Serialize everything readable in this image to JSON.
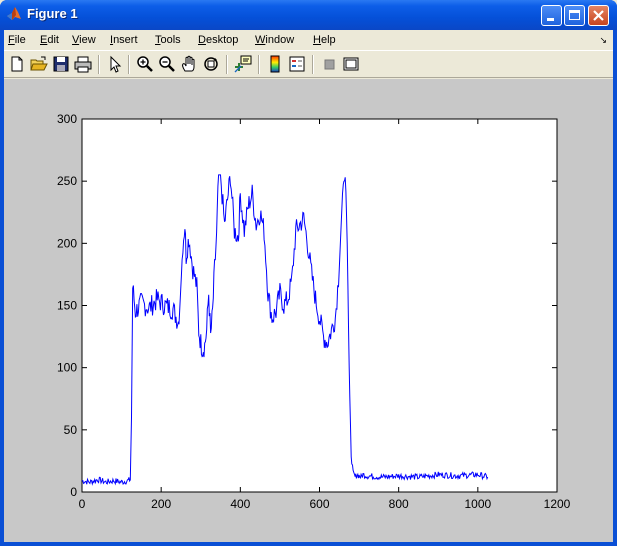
{
  "window": {
    "title": "Figure 1",
    "title_icon": "matlab-logo-icon",
    "controls": [
      "minimize-icon",
      "maximize-icon",
      "close-icon"
    ]
  },
  "menu": {
    "items": [
      {
        "label": "File",
        "hotkey_index": 0
      },
      {
        "label": "Edit",
        "hotkey_index": 0
      },
      {
        "label": "View",
        "hotkey_index": 0
      },
      {
        "label": "Insert",
        "hotkey_index": 0
      },
      {
        "label": "Tools",
        "hotkey_index": 0
      },
      {
        "label": "Desktop",
        "hotkey_index": 0
      },
      {
        "label": "Window",
        "hotkey_index": 0
      },
      {
        "label": "Help",
        "hotkey_index": 0
      }
    ],
    "overflow_icon": "chevron-icon"
  },
  "toolbar": {
    "buttons": [
      "new-figure-icon",
      "open-file-icon",
      "save-icon",
      "print-icon",
      "edit-plot-arrow-icon",
      "zoom-in-icon",
      "zoom-out-icon",
      "pan-hand-icon",
      "rotate-3d-icon",
      "data-cursor-icon",
      "insert-colorbar-icon",
      "insert-legend-icon",
      "hide-plot-tools-icon",
      "show-plot-tools-icon"
    ]
  },
  "colors": {
    "plot_line": "#0000ff",
    "figure_background": "#c8c8c8",
    "axes_background": "#ffffff"
  },
  "chart_data": {
    "type": "line",
    "title": "",
    "xlabel": "",
    "ylabel": "",
    "xlim": [
      0,
      1200
    ],
    "ylim": [
      0,
      300
    ],
    "xticks": [
      0,
      200,
      400,
      600,
      800,
      1000,
      1200
    ],
    "yticks": [
      0,
      50,
      100,
      150,
      200,
      250,
      300
    ],
    "grid": false,
    "series": [
      {
        "x": [
          0,
          20,
          40,
          60,
          80,
          100,
          115,
          122,
          125,
          128,
          135,
          150,
          170,
          190,
          210,
          230,
          245,
          255,
          260,
          263,
          270,
          280,
          290,
          295,
          300,
          305,
          310,
          315,
          320,
          325,
          330,
          335,
          340,
          345,
          350,
          360,
          375,
          385,
          395,
          400,
          410,
          420,
          430,
          440,
          450,
          460,
          470,
          480,
          490,
          500,
          510,
          520,
          530,
          540,
          550,
          560,
          570,
          580,
          590,
          600,
          610,
          620,
          630,
          640,
          650,
          660,
          665,
          670,
          675,
          680,
          685,
          690,
          695,
          700,
          705,
          710,
          720,
          760,
          800,
          850,
          900,
          950,
          1000,
          1025
        ],
        "y": [
          9,
          8,
          10,
          8,
          9,
          8,
          9,
          10,
          60,
          165,
          145,
          152,
          148,
          155,
          150,
          147,
          135,
          200,
          215,
          190,
          205,
          180,
          165,
          130,
          120,
          115,
          118,
          130,
          160,
          125,
          145,
          180,
          205,
          255,
          255,
          215,
          255,
          210,
          205,
          240,
          210,
          230,
          240,
          215,
          225,
          210,
          160,
          140,
          145,
          160,
          150,
          155,
          170,
          210,
          215,
          220,
          200,
          175,
          155,
          140,
          125,
          120,
          130,
          140,
          180,
          255,
          250,
          200,
          100,
          30,
          15,
          12,
          14,
          13,
          12,
          14,
          13,
          12,
          13,
          12,
          14,
          13,
          14,
          12
        ]
      }
    ]
  }
}
